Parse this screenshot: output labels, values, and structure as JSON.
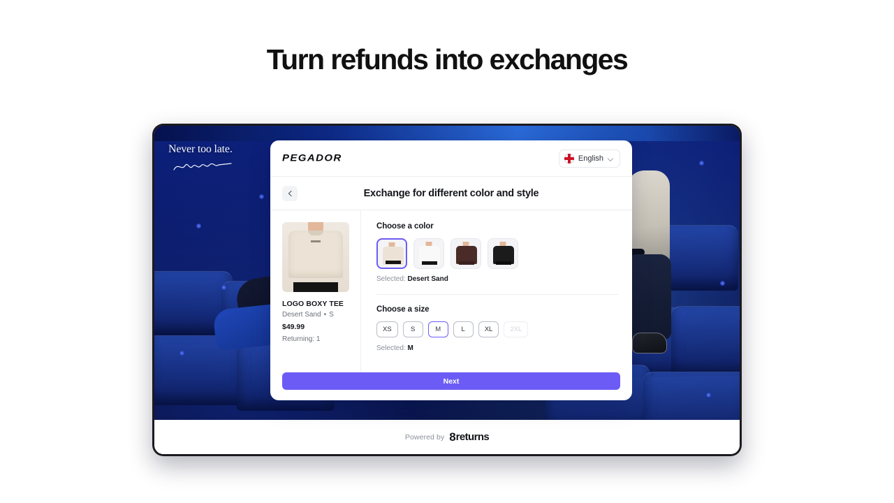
{
  "headline": "Turn refunds into exchanges",
  "background": {
    "overlay_text": "Never too late.",
    "signature_alt": "handwritten-signature"
  },
  "card": {
    "brand": "PEGADOR",
    "language": {
      "label": "English",
      "flag": "uk-flag-icon",
      "chevron": "chevron-down-icon"
    },
    "back_button": "chevron-left-icon",
    "subhead_title": "Exchange for different color and style",
    "product": {
      "title": "LOGO BOXY TEE",
      "color": "Desert Sand",
      "separator": "•",
      "size": "S",
      "price": "$49.99",
      "returning": "Returning: 1"
    },
    "color_section": {
      "title": "Choose a color",
      "options": [
        {
          "name": "Desert Sand",
          "tee_color": "#ece3d6",
          "hem_color": "#141414",
          "selected": true
        },
        {
          "name": "White",
          "tee_color": "#f7f7f7",
          "hem_color": "#141414",
          "selected": false
        },
        {
          "name": "Dark Brown",
          "tee_color": "#4a2b28",
          "hem_color": "#3a221f",
          "selected": false
        },
        {
          "name": "Black",
          "tee_color": "#1b1b1b",
          "hem_color": "#0d0d0d",
          "selected": false
        }
      ],
      "selected_prefix": "Selected: ",
      "selected_value": "Desert Sand"
    },
    "size_section": {
      "title": "Choose a size",
      "options": [
        {
          "label": "XS",
          "state": "default"
        },
        {
          "label": "S",
          "state": "default"
        },
        {
          "label": "M",
          "state": "selected"
        },
        {
          "label": "L",
          "state": "default"
        },
        {
          "label": "XL",
          "state": "default"
        },
        {
          "label": "2XL",
          "state": "disabled"
        }
      ],
      "selected_prefix": "Selected: ",
      "selected_value": "M"
    },
    "next_button": "Next"
  },
  "footer": {
    "powered_by": "Powered by",
    "logo_glyph": "8",
    "logo_text": "returns"
  },
  "colors": {
    "accent": "#6c5cf5",
    "text_primary": "#15171c",
    "text_muted": "#6b7078",
    "border": "#e6e8ed"
  }
}
